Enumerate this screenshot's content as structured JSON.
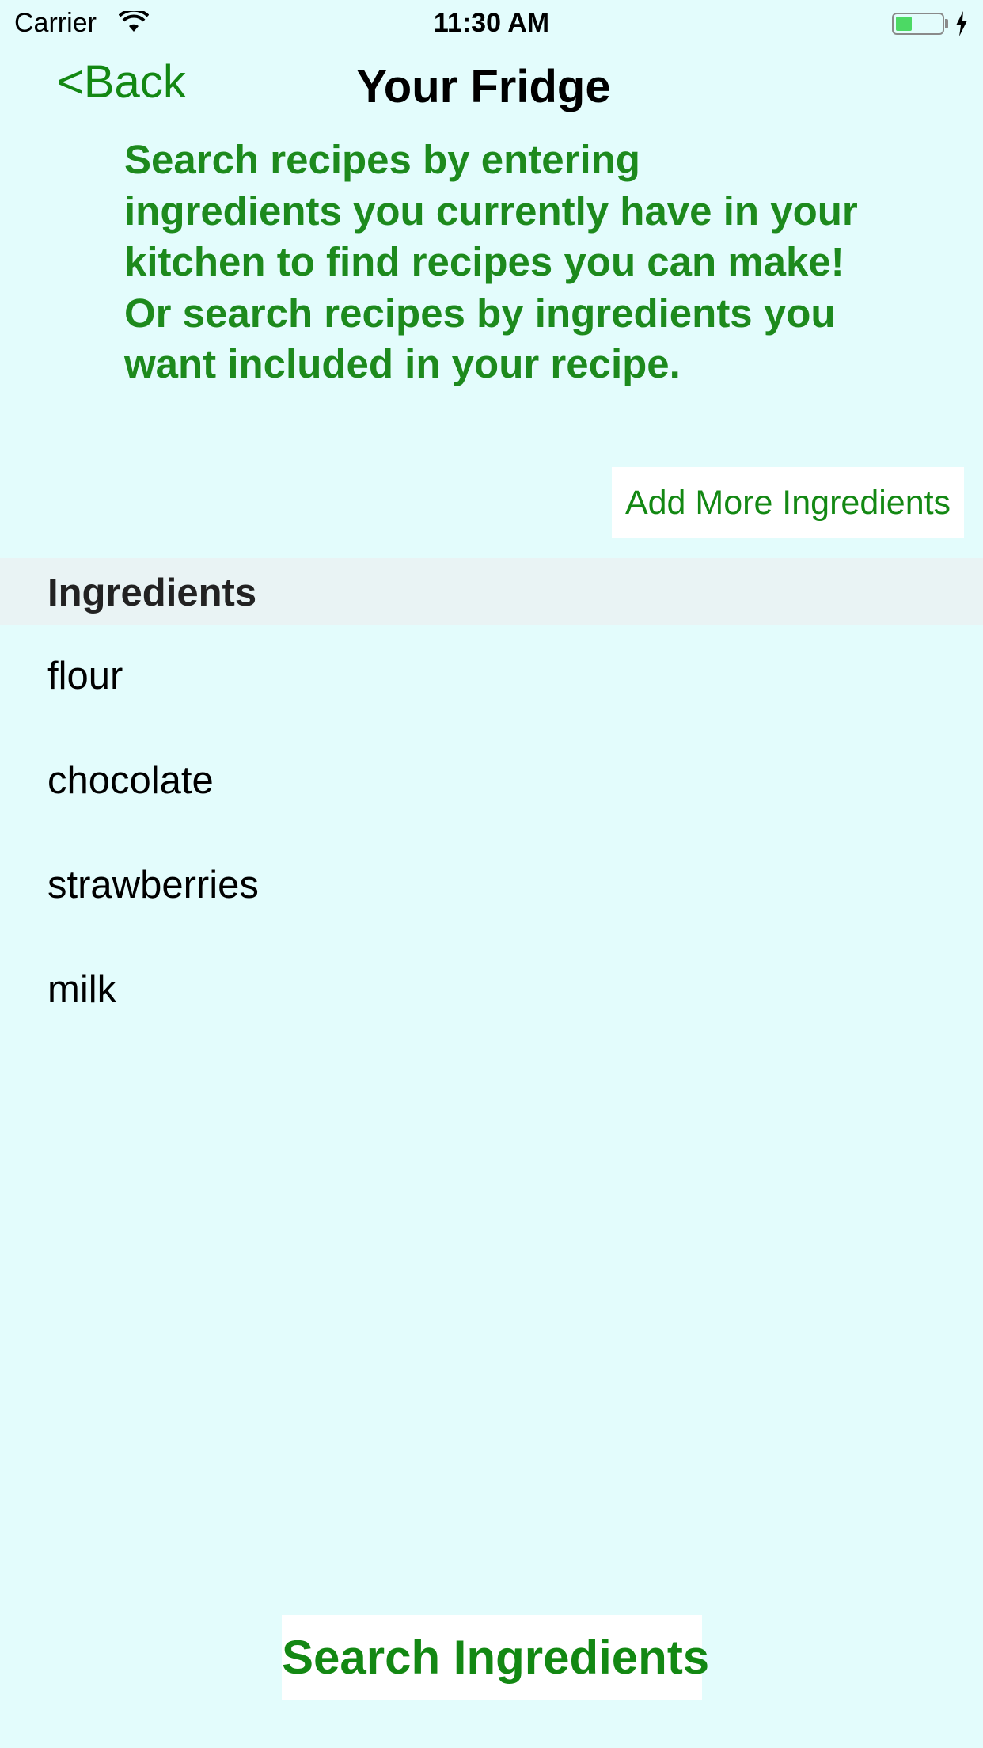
{
  "status_bar": {
    "carrier": "Carrier",
    "time": "11:30 AM",
    "battery_level": 0.35,
    "battery_color": "#4cd964",
    "icons": [
      "wifi-icon",
      "battery-icon",
      "charging-bolt-icon"
    ]
  },
  "nav": {
    "back_label": "<Back",
    "title": "Your Fridge"
  },
  "description": "Search recipes by entering ingredients you currently have in your kitchen to find recipes you can make! Or search recipes by ingredients you want included in your recipe.",
  "add_more_label": "Add More Ingredients",
  "ingredients": {
    "header": "Ingredients",
    "items": [
      {
        "label": "flour"
      },
      {
        "label": "chocolate"
      },
      {
        "label": "strawberries"
      },
      {
        "label": "milk"
      }
    ]
  },
  "search_label": "Search Ingredients",
  "colors": {
    "background": "#e3fcfc",
    "accent_green": "#138813",
    "section_header_bg": "#e9f3f4",
    "button_bg": "#ffffff"
  }
}
